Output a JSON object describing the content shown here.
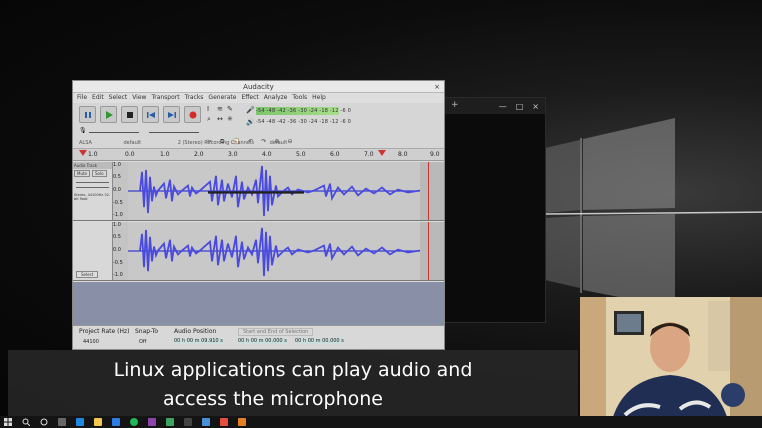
{
  "audacity": {
    "title": "Audacity",
    "close_glyph": "×",
    "menu": [
      "File",
      "Edit",
      "Select",
      "View",
      "Transport",
      "Tracks",
      "Generate",
      "Effect",
      "Analyze",
      "Tools",
      "Help"
    ],
    "record_meter_ticks": "-54  -48  -42  -36  -30  -24  -18  -12  -6  0",
    "play_meter_ticks": "-54  -48  -42  -36  -30  -24  -18  -12  -6  0",
    "device_host": "ALSA",
    "rec_device": "default",
    "rec_channels": "2 (Stereo) Recording Channels",
    "play_device": "default",
    "ruler_ticks": [
      "1.0",
      "0.0",
      "1.0",
      "2.0",
      "3.0",
      "4.0",
      "5.0",
      "6.0",
      "7.0",
      "8.0",
      "9.0"
    ],
    "track_name": "Audio Track",
    "track_mute": "Mute",
    "track_solo": "Solo",
    "track_info": "Stereo, 44100Hz 32-bit float",
    "track_select": "Select",
    "scale_top": [
      "1.0",
      "0.5",
      "0.0",
      "-0.5",
      "-1.0"
    ],
    "scale_bottom": [
      "1.0",
      "0.5",
      "0.0",
      "-0.5",
      "-1.0"
    ],
    "project_rate_label": "Project Rate (Hz)",
    "project_rate_value": "44100",
    "snap_to_label": "Snap-To",
    "snap_to_value": "Off",
    "audio_position_label": "Audio Position",
    "audio_position_value": "00 h 00 m 09.910 s",
    "selection_label": "Start and End of Selection",
    "selection_start": "00 h 00 m 00.000 s",
    "selection_end": "00 h 00 m 00.000 s"
  },
  "dark_window": {
    "plus": "+",
    "controls": [
      "—",
      "□",
      "×"
    ]
  },
  "caption": {
    "line1": "Linux applications can play audio and",
    "line2": "access the microphone"
  },
  "taskbar": {
    "icons": [
      "windows-start",
      "search",
      "task-view",
      "app",
      "edge",
      "file-explorer",
      "store",
      "spotify",
      "visual-studio",
      "app",
      "terminal",
      "app",
      "app",
      "app"
    ]
  }
}
